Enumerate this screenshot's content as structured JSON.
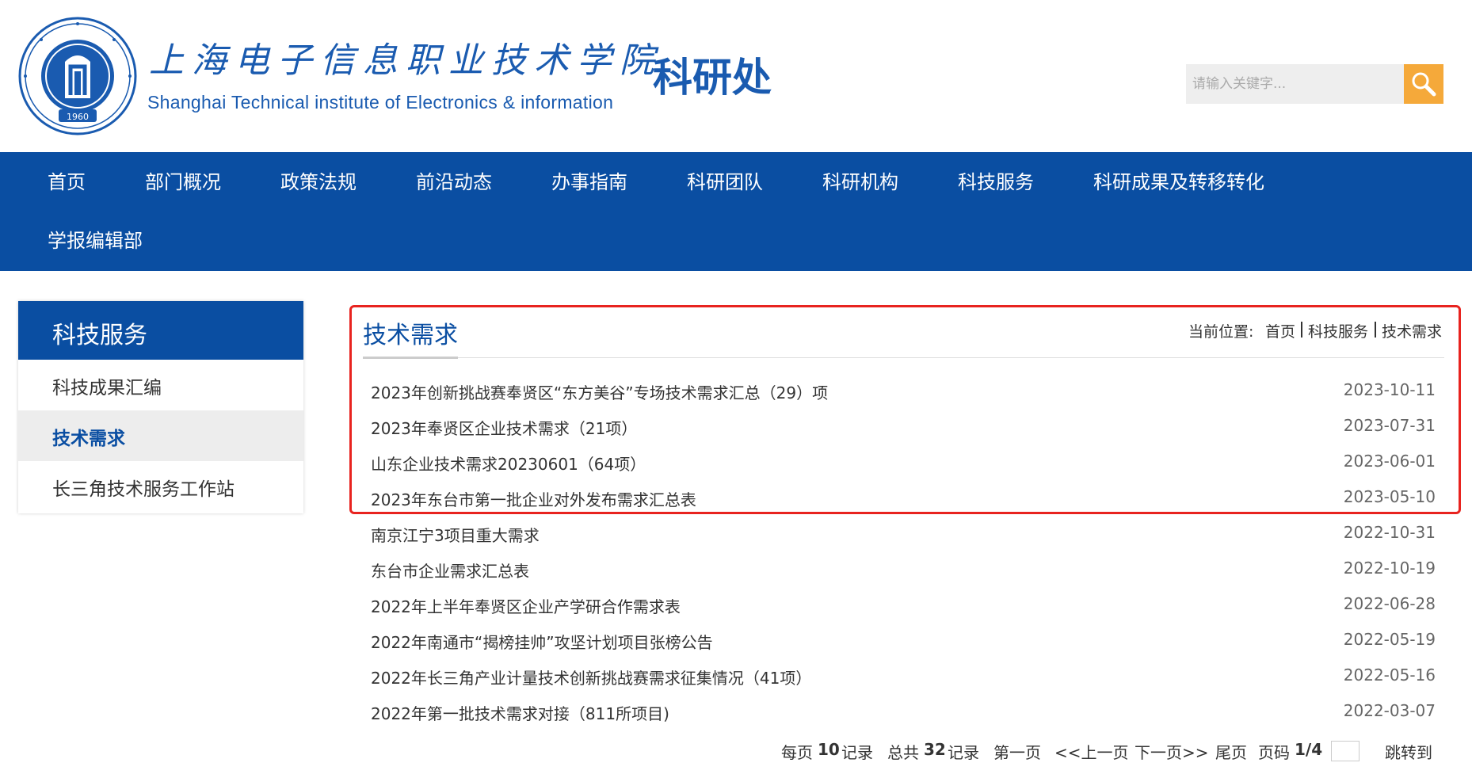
{
  "header": {
    "logo_cn": "上海电子信息职业技术学院",
    "logo_en": "Shanghai Technical institute of Electronics & information",
    "seal_year": "1960",
    "dept_title": "科研处",
    "search_placeholder": "请输入关键字...",
    "search_icon": "magnifier-icon",
    "brand_color": "#1a5bb0",
    "search_button_color": "#f5a93a"
  },
  "nav": {
    "color": "#0a4ea2",
    "items": [
      "首页",
      "部门概况",
      "政策法规",
      "前沿动态",
      "办事指南",
      "科研团队",
      "科研机构",
      "科技服务",
      "科研成果及转移转化",
      "学报编辑部"
    ]
  },
  "sidebar": {
    "title": "科技服务",
    "items": [
      {
        "label": "科技成果汇编",
        "active": false
      },
      {
        "label": "技术需求",
        "active": true
      },
      {
        "label": "长三角技术服务工作站",
        "active": false
      }
    ]
  },
  "main": {
    "title": "技术需求",
    "breadcrumb": {
      "prefix": "当前位置:",
      "items": [
        "首页",
        "科技服务",
        "技术需求"
      ]
    },
    "highlight_color": "#e8231f",
    "rows": [
      {
        "title": "2023年创新挑战赛奉贤区“东方美谷”专场技术需求汇总（29）项",
        "date": "2023-10-11"
      },
      {
        "title": "2023年奉贤区企业技术需求（21项）",
        "date": "2023-07-31"
      },
      {
        "title": "山东企业技术需求20230601（64项）",
        "date": "2023-06-01"
      },
      {
        "title": "2023年东台市第一批企业对外发布需求汇总表",
        "date": "2023-05-10"
      },
      {
        "title": "南京江宁3项目重大需求",
        "date": "2022-10-31"
      },
      {
        "title": "东台市企业需求汇总表",
        "date": "2022-10-19"
      },
      {
        "title": "2022年上半年奉贤区企业产学研合作需求表",
        "date": "2022-06-28"
      },
      {
        "title": "2022年南通市“揭榜挂帅”攻坚计划项目张榜公告",
        "date": "2022-05-19"
      },
      {
        "title": "2022年长三角产业计量技术创新挑战赛需求征集情况（41项）",
        "date": "2022-05-16"
      },
      {
        "title": "2022年第一批技术需求对接（811所项目)",
        "date": "2022-03-07"
      }
    ]
  },
  "pager": {
    "per_page_prefix": "每页",
    "per_page": "10",
    "per_page_suffix": "记录",
    "total_prefix": "总共",
    "total": "32",
    "total_suffix": "记录",
    "first": "第一页",
    "prev": "<<上一页",
    "next": "下一页>>",
    "last": "尾页",
    "page_prefix": "页码",
    "page": "1/4",
    "goto": "跳转到"
  }
}
